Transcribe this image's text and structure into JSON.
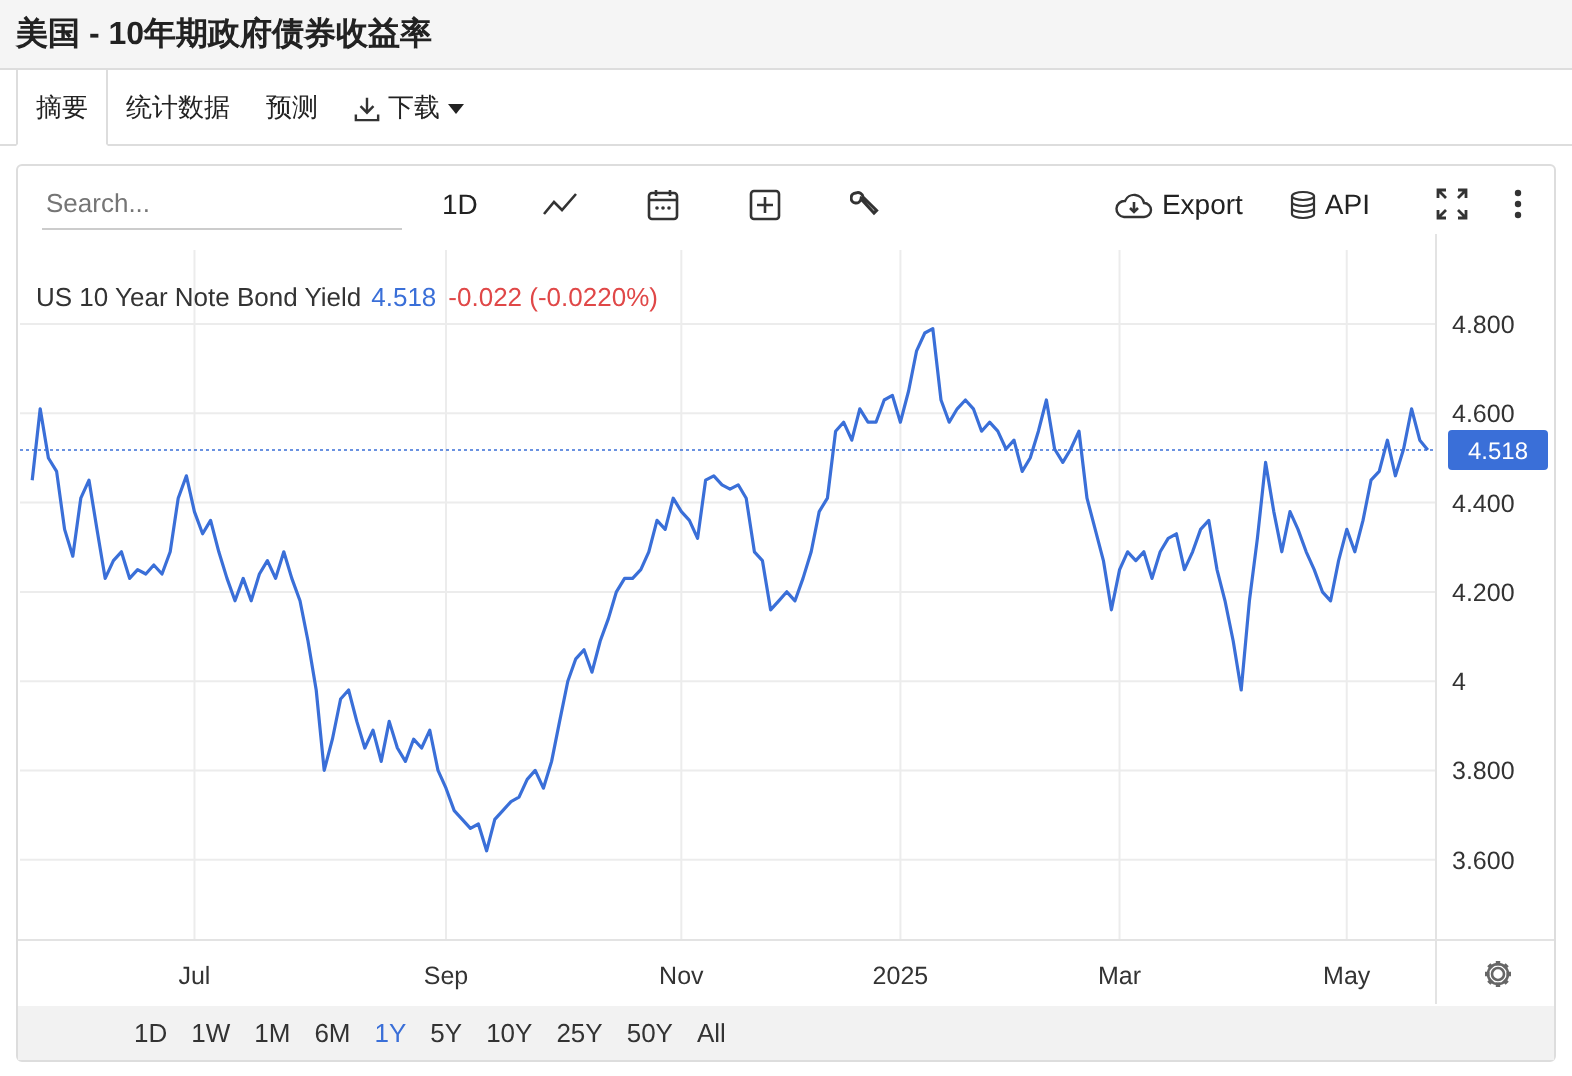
{
  "page_title": "美国 - 10年期政府债券收益率",
  "tabs": [
    {
      "label": "摘要",
      "selected": true,
      "kind": "text"
    },
    {
      "label": "统计数据",
      "selected": false,
      "kind": "text"
    },
    {
      "label": "预测",
      "selected": false,
      "kind": "text"
    },
    {
      "label": "下载",
      "selected": false,
      "kind": "download"
    }
  ],
  "toolbar": {
    "search": {
      "placeholder": "Search..."
    },
    "interval": "1D",
    "export": "Export",
    "api": "API"
  },
  "legend": {
    "last": "4.518",
    "change": "-0.022 (-0.0220%)"
  },
  "price_label": "4.518",
  "chart_data": {
    "type": "line",
    "grid": true,
    "ylim": [
      3.42,
      4.966
    ],
    "ref_lines": [
      {
        "axis": "y",
        "value": 4.518,
        "color": "#3a6fd8"
      }
    ],
    "categories": [
      null,
      null,
      null,
      null,
      null,
      null,
      null,
      null,
      null,
      null,
      null,
      null,
      null,
      null,
      null,
      null,
      null,
      null,
      null,
      null,
      "Jul",
      null,
      null,
      null,
      null,
      null,
      null,
      null,
      null,
      null,
      null,
      null,
      null,
      null,
      null,
      null,
      null,
      null,
      null,
      null,
      null,
      null,
      null,
      null,
      null,
      null,
      null,
      null,
      null,
      null,
      null,
      "Sep",
      null,
      null,
      null,
      null,
      null,
      null,
      null,
      null,
      null,
      null,
      null,
      null,
      null,
      null,
      null,
      null,
      null,
      null,
      null,
      null,
      null,
      null,
      null,
      null,
      null,
      null,
      null,
      null,
      "Nov",
      null,
      null,
      null,
      null,
      null,
      null,
      null,
      null,
      null,
      null,
      null,
      null,
      null,
      null,
      null,
      null,
      null,
      null,
      null,
      null,
      null,
      null,
      null,
      null,
      null,
      null,
      "2025",
      null,
      null,
      null,
      null,
      null,
      null,
      null,
      null,
      null,
      null,
      null,
      null,
      null,
      null,
      null,
      null,
      null,
      null,
      null,
      null,
      null,
      null,
      null,
      null,
      null,
      null,
      "Mar",
      null,
      null,
      null,
      null,
      null,
      null,
      null,
      null,
      null,
      null,
      null,
      null,
      null,
      null,
      null,
      null,
      null,
      null,
      null,
      null,
      null,
      null,
      null,
      null,
      null,
      null,
      null,
      "May",
      null,
      null,
      null,
      null,
      null,
      null,
      null,
      null,
      null,
      null
    ],
    "yticks": [
      {
        "value": 4.8,
        "label": "4.800"
      },
      {
        "value": 4.6,
        "label": "4.600"
      },
      {
        "value": 4.4,
        "label": "4.400"
      },
      {
        "value": 4.2,
        "label": "4.200"
      },
      {
        "value": 4,
        "label": "4"
      },
      {
        "value": 3.8,
        "label": "3.800"
      },
      {
        "value": 3.6,
        "label": "3.600"
      }
    ],
    "series": [
      {
        "name": "US 10 Year Note Bond Yield",
        "color": "#3a6fd8",
        "values": [
          4.45,
          4.61,
          4.5,
          4.47,
          4.34,
          4.28,
          4.41,
          4.45,
          4.34,
          4.23,
          4.27,
          4.29,
          4.23,
          4.25,
          4.24,
          4.26,
          4.24,
          4.29,
          4.41,
          4.46,
          4.38,
          4.33,
          4.36,
          4.29,
          4.23,
          4.18,
          4.23,
          4.18,
          4.24,
          4.27,
          4.23,
          4.29,
          4.23,
          4.18,
          4.09,
          3.98,
          3.8,
          3.87,
          3.96,
          3.98,
          3.91,
          3.85,
          3.89,
          3.82,
          3.91,
          3.85,
          3.82,
          3.87,
          3.85,
          3.89,
          3.8,
          3.76,
          3.71,
          3.69,
          3.67,
          3.68,
          3.62,
          3.69,
          3.71,
          3.73,
          3.74,
          3.78,
          3.8,
          3.76,
          3.82,
          3.91,
          4.0,
          4.05,
          4.07,
          4.02,
          4.09,
          4.14,
          4.2,
          4.23,
          4.23,
          4.25,
          4.29,
          4.36,
          4.34,
          4.41,
          4.38,
          4.36,
          4.32,
          4.45,
          4.46,
          4.44,
          4.43,
          4.44,
          4.41,
          4.29,
          4.27,
          4.16,
          4.18,
          4.2,
          4.18,
          4.23,
          4.29,
          4.38,
          4.41,
          4.56,
          4.58,
          4.54,
          4.61,
          4.58,
          4.58,
          4.63,
          4.64,
          4.58,
          4.65,
          4.74,
          4.78,
          4.79,
          4.63,
          4.58,
          4.61,
          4.63,
          4.61,
          4.56,
          4.58,
          4.56,
          4.52,
          4.54,
          4.47,
          4.5,
          4.56,
          4.63,
          4.52,
          4.49,
          4.52,
          4.56,
          4.41,
          4.34,
          4.27,
          4.16,
          4.25,
          4.29,
          4.27,
          4.29,
          4.23,
          4.29,
          4.32,
          4.33,
          4.25,
          4.29,
          4.34,
          4.36,
          4.25,
          4.18,
          4.09,
          3.98,
          4.18,
          4.32,
          4.49,
          4.38,
          4.29,
          4.38,
          4.34,
          4.29,
          4.25,
          4.2,
          4.18,
          4.27,
          4.34,
          4.29,
          4.36,
          4.45,
          4.47,
          4.54,
          4.46,
          4.52,
          4.61,
          4.54,
          4.518
        ]
      }
    ]
  },
  "ranges": [
    {
      "label": "1D",
      "selected": false
    },
    {
      "label": "1W",
      "selected": false
    },
    {
      "label": "1M",
      "selected": false
    },
    {
      "label": "6M",
      "selected": false
    },
    {
      "label": "1Y",
      "selected": true
    },
    {
      "label": "5Y",
      "selected": false
    },
    {
      "label": "10Y",
      "selected": false
    },
    {
      "label": "25Y",
      "selected": false
    },
    {
      "label": "50Y",
      "selected": false
    },
    {
      "label": "All",
      "selected": false
    }
  ]
}
